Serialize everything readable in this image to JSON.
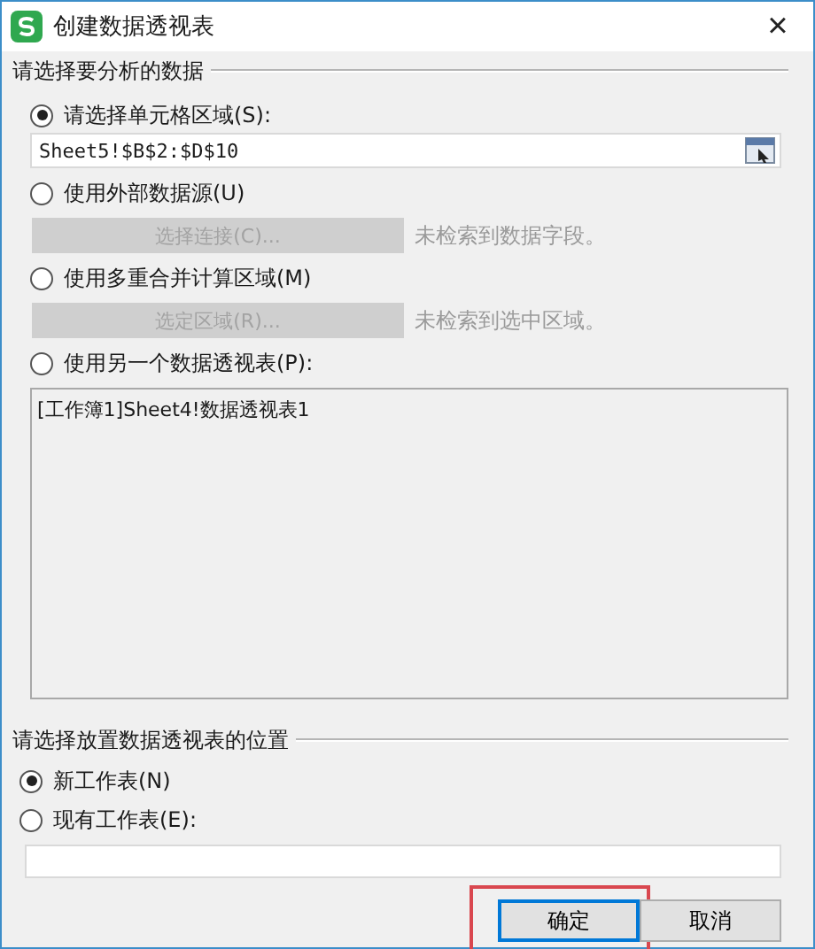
{
  "window": {
    "title": "创建数据透视表",
    "close": "×"
  },
  "source": {
    "heading": "请选择要分析的数据",
    "options": [
      {
        "kind": "range",
        "label": "请选择单元格区域(S):",
        "selected": true,
        "value": "Sheet5!$B$2:$D$10"
      },
      {
        "kind": "action",
        "label": "使用外部数据源(U)",
        "selected": false,
        "button": "选择连接(C)...",
        "disabled": true,
        "note": "未检索到数据字段。"
      },
      {
        "kind": "action",
        "label": "使用多重合并计算区域(M)",
        "selected": false,
        "button": "选定区域(R)...",
        "disabled": true,
        "note": "未检索到选中区域。"
      },
      {
        "kind": "list",
        "label": "使用另一个数据透视表(P):",
        "selected": false,
        "items": [
          "[工作簿1]Sheet4!数据透视表1"
        ]
      }
    ]
  },
  "destination": {
    "heading": "请选择放置数据透视表的位置",
    "options": [
      {
        "kind": "plain",
        "label": "新工作表(N)",
        "selected": true
      },
      {
        "kind": "field",
        "label": "现有工作表(E):",
        "selected": false
      }
    ]
  },
  "buttons": [
    {
      "label": "确定",
      "default": true,
      "highlighted": true
    },
    {
      "label": "取消",
      "default": false,
      "highlighted": false
    }
  ]
}
